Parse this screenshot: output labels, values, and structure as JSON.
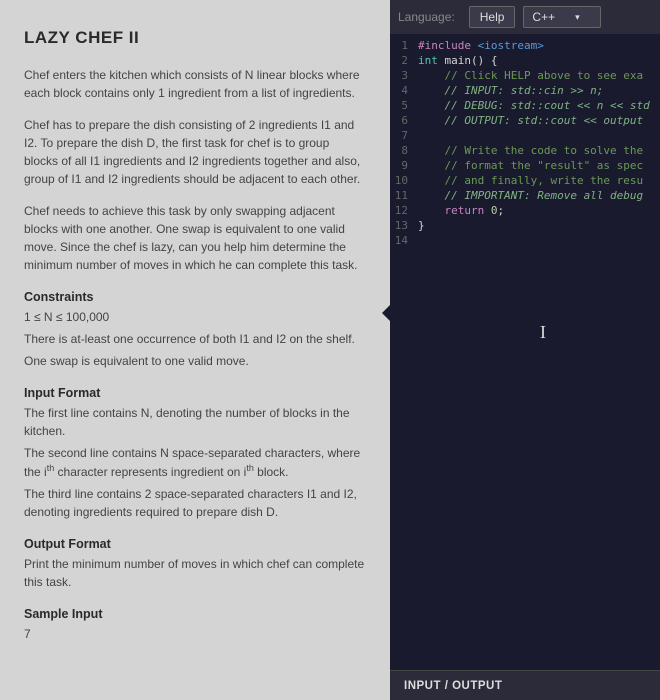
{
  "problem": {
    "title": "LAZY CHEF II",
    "para1": "Chef enters the kitchen which consists of N linear blocks where each block contains only 1 ingredient from a list of ingredients.",
    "para2": "Chef has to prepare the dish consisting of 2 ingredients I1 and I2. To prepare the dish D, the first task for chef is to group blocks of all I1 ingredients and I2 ingredients together and also, group of I1 and I2 ingredients should be adjacent to each other.",
    "para3": "Chef needs to achieve this task by only swapping adjacent blocks with one another. One swap is equivalent to one valid move. Since the chef is lazy, can you help him determine the minimum number of moves in which he can complete this task.",
    "constraints_heading": "Constraints",
    "constraint1": "1 ≤ N ≤ 100,000",
    "constraint2": "There is at-least one occurrence of both I1 and I2 on the shelf.",
    "constraint3": "One swap is equivalent to one valid move.",
    "input_heading": "Input Format",
    "input1": "The first line contains N, denoting the number of blocks in the kitchen.",
    "input2_a": "The second line contains N space-separated characters, where the i",
    "input2_b": " character represents ingredient on i",
    "input2_c": " block.",
    "input3": "The third line contains 2 space-separated characters I1 and I2, denoting ingredients required to prepare dish D.",
    "output_heading": "Output Format",
    "output1": "Print the minimum number of moves in which chef can complete this task.",
    "sample_heading": "Sample Input",
    "sample_val": "7"
  },
  "topbar": {
    "language_label": "Language:",
    "help_label": "Help",
    "lang_value": "C++"
  },
  "code": {
    "lines": [
      "1",
      "2",
      "3",
      "4",
      "5",
      "6",
      "7",
      "8",
      "9",
      "10",
      "11",
      "12",
      "13",
      "14"
    ],
    "l1a": "#include ",
    "l1b": "<iostream>",
    "l2a": "int",
    "l2b": " main() {",
    "l3": "    // Click HELP above to see exa",
    "l4": "    // INPUT: std::cin >> n;",
    "l5": "    // DEBUG: std::cout << n << std",
    "l6": "    // OUTPUT: std::cout << output",
    "l8": "    // Write the code to solve the",
    "l9": "    // format the \"result\" as spec",
    "l10": "    // and finally, write the resu",
    "l11": "    // IMPORTANT: Remove all debug",
    "l12a": "    return ",
    "l12b": "0",
    "l12c": ";",
    "l13": "}"
  },
  "io": {
    "label": "INPUT / OUTPUT"
  }
}
